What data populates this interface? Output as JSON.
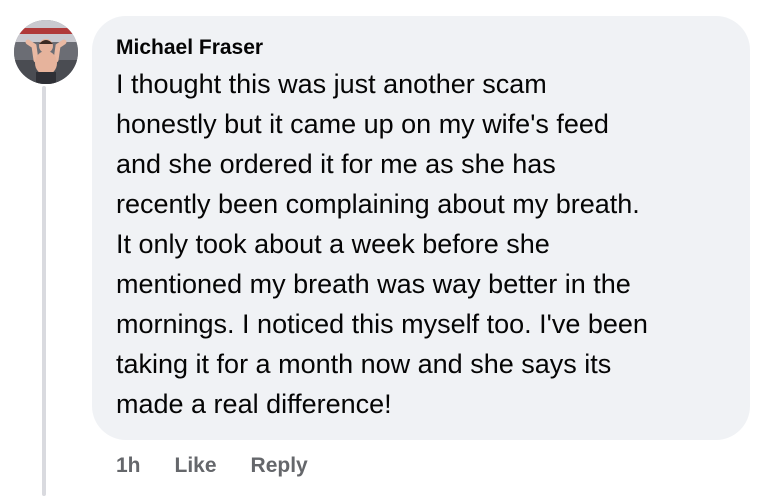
{
  "comment": {
    "author": "Michael Fraser",
    "avatar_icon": "profile-photo-avatar",
    "text_lines": [
      "I thought this was just another scam",
      "honestly but it came up on my wife's feed",
      "and she ordered it for me as she has",
      "recently been complaining about my breath.",
      "It only took about a week before she",
      "mentioned my breath was way better in the",
      "mornings. I noticed this myself too. I've been",
      "taking it for a month now and she says its",
      "made a real difference!"
    ],
    "timestamp": "1h",
    "like_label": "Like",
    "reply_label": "Reply"
  },
  "colors": {
    "bubble_background": "#f0f2f5",
    "text": "#050505",
    "secondary_text": "#65676b",
    "thread_line": "#d9dadf"
  }
}
